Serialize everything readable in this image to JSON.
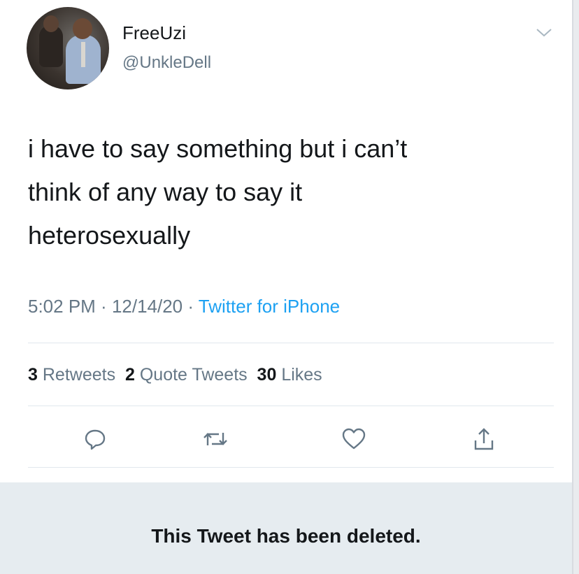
{
  "tweet": {
    "display_name": "FreeUzi",
    "handle": "@UnkleDell",
    "text": "i have to say something but i can’t\nthink of any way to say it\nheterosexually",
    "time": "5:02 PM",
    "date": "12/14/20",
    "separator": " · ",
    "source": "Twitter for iPhone",
    "stats": {
      "retweets_count": "3",
      "retweets_label": "Retweets",
      "quotes_count": "2",
      "quotes_label": "Quote Tweets",
      "likes_count": "30",
      "likes_label": "Likes"
    },
    "icons": [
      "chevron-down-icon",
      "reply-icon",
      "retweet-icon",
      "like-icon",
      "share-icon"
    ]
  },
  "deleted_notice": "This Tweet has been deleted.",
  "colors": {
    "text": "#14171a",
    "secondary": "#657786",
    "link": "#1da1f2",
    "deleted_bg": "#e6ecf0"
  }
}
